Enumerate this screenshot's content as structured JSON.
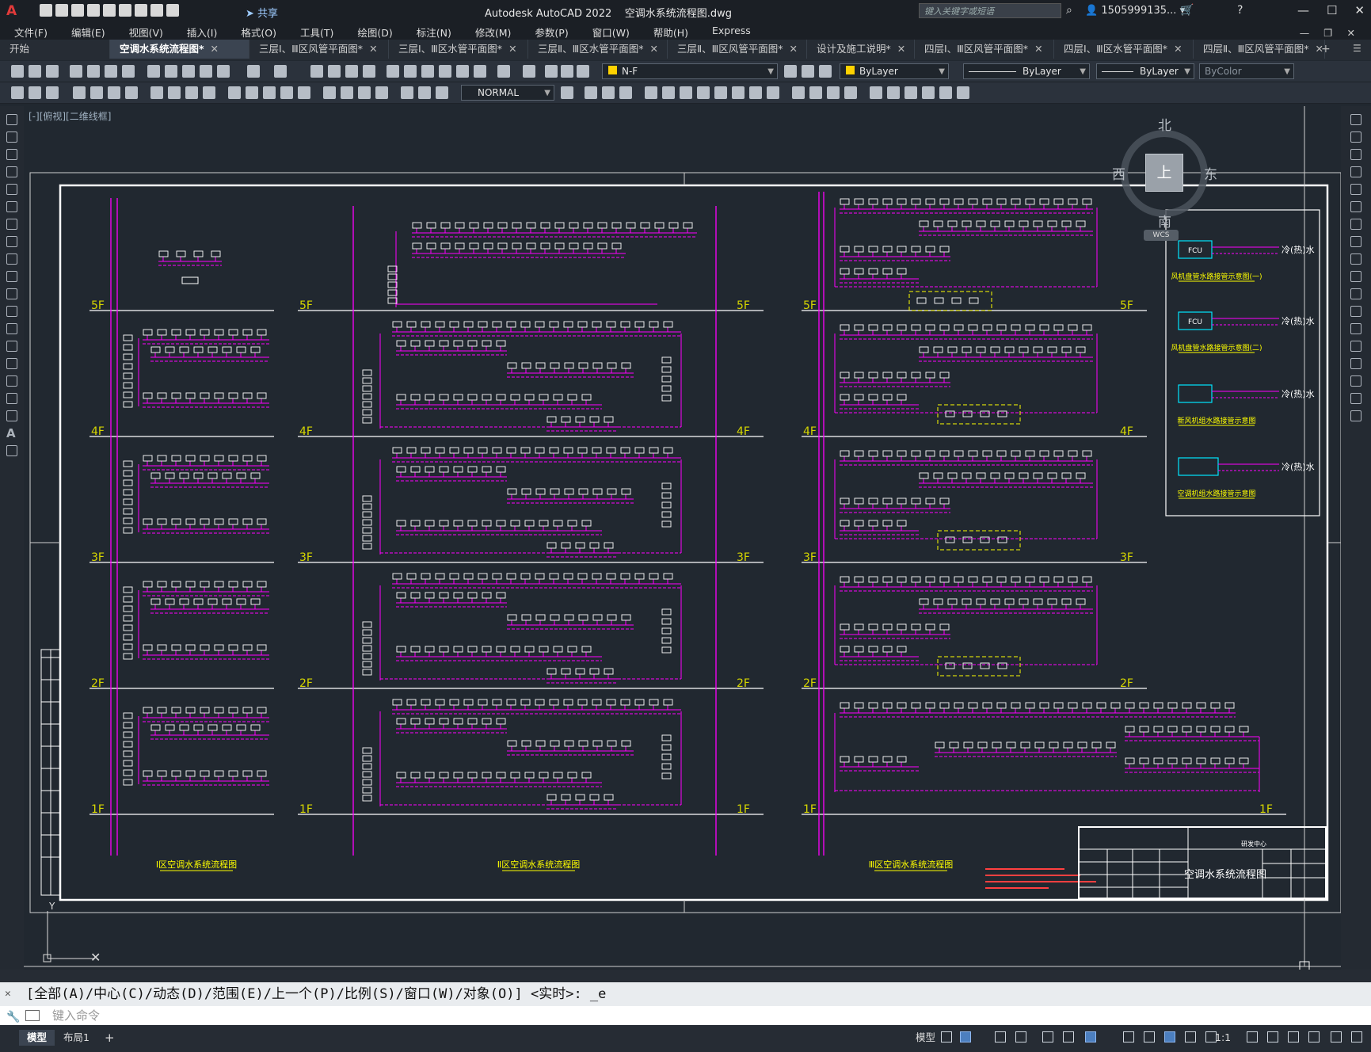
{
  "app": {
    "logo": "A",
    "share_label": "共享",
    "product": "Autodesk AutoCAD 2022",
    "filename": "空调水系统流程图.dwg",
    "search_placeholder": "键入关键字或短语",
    "user": "1505999135..."
  },
  "menu": [
    "文件(F)",
    "编辑(E)",
    "视图(V)",
    "插入(I)",
    "格式(O)",
    "工具(T)",
    "绘图(D)",
    "标注(N)",
    "修改(M)",
    "参数(P)",
    "窗口(W)",
    "帮助(H)",
    "Express"
  ],
  "tabs": [
    {
      "label": "开始",
      "closable": false
    },
    {
      "label": "空调水系统流程图*",
      "active": true,
      "closable": true
    },
    {
      "label": "三层Ⅰ、Ⅲ区风管平面图*",
      "closable": true
    },
    {
      "label": "三层Ⅰ、Ⅲ区水管平面图*",
      "closable": true
    },
    {
      "label": "三层Ⅱ、Ⅲ区水管平面图*",
      "closable": true
    },
    {
      "label": "三层Ⅱ、Ⅲ区风管平面图*",
      "closable": true
    },
    {
      "label": "设计及施工说明*",
      "closable": true
    },
    {
      "label": "四层Ⅰ、Ⅲ区风管平面图*",
      "closable": true
    },
    {
      "label": "四层Ⅰ、Ⅲ区水管平面图*",
      "closable": true
    },
    {
      "label": "四层Ⅱ、Ⅲ区风管平面图*",
      "closable": true
    }
  ],
  "properties": {
    "layer": "N-F",
    "color": "ByLayer",
    "linetype": "ByLayer",
    "lineweight": "ByLayer",
    "plotstyle": "ByColor",
    "dimstyle": "NORMAL",
    "layer_color": "#ffd200"
  },
  "viewport_label": "[-][俯视][二维线框]",
  "viewcube": {
    "north": "北",
    "south": "南",
    "east": "东",
    "west": "西",
    "top": "上",
    "wcs": "WCS"
  },
  "drawing": {
    "floors": [
      "5F",
      "4F",
      "3F",
      "2F",
      "1F"
    ],
    "zone_titles": [
      "Ⅰ区空调水系统流程图",
      "Ⅱ区空调水系统流程图",
      "Ⅲ区空调水系统流程图"
    ],
    "legend_titles": [
      "风机盘管水路接管示意图(一)",
      "风机盘管水路接管示意图(二)",
      "新风机组水路接管示意图",
      "空调机组水路接管示意图"
    ],
    "legend_labels": [
      "冷(热)水",
      "冷(热)水",
      "冷(热)水",
      "冷(热)水"
    ],
    "legend_fcu": "FCU",
    "title_block": {
      "drawing_name": "空调水系统流程图",
      "design_center": "研发中心"
    },
    "colors": {
      "pipe": "#ff00ff",
      "floor_text": "#d6d600",
      "title": "#ffff00",
      "border": "#ffffff",
      "notes": "#ff4040",
      "legend_box": "#00e5ff"
    }
  },
  "command": {
    "history": "[全部(A)/中心(C)/动态(D)/范围(E)/上一个(P)/比例(S)/窗口(W)/对象(O)] <实时>: _e",
    "placeholder": "键入命令"
  },
  "status": {
    "layout_tabs": [
      "模型",
      "布局1"
    ],
    "model_label": "模型",
    "scale": "1:1"
  }
}
